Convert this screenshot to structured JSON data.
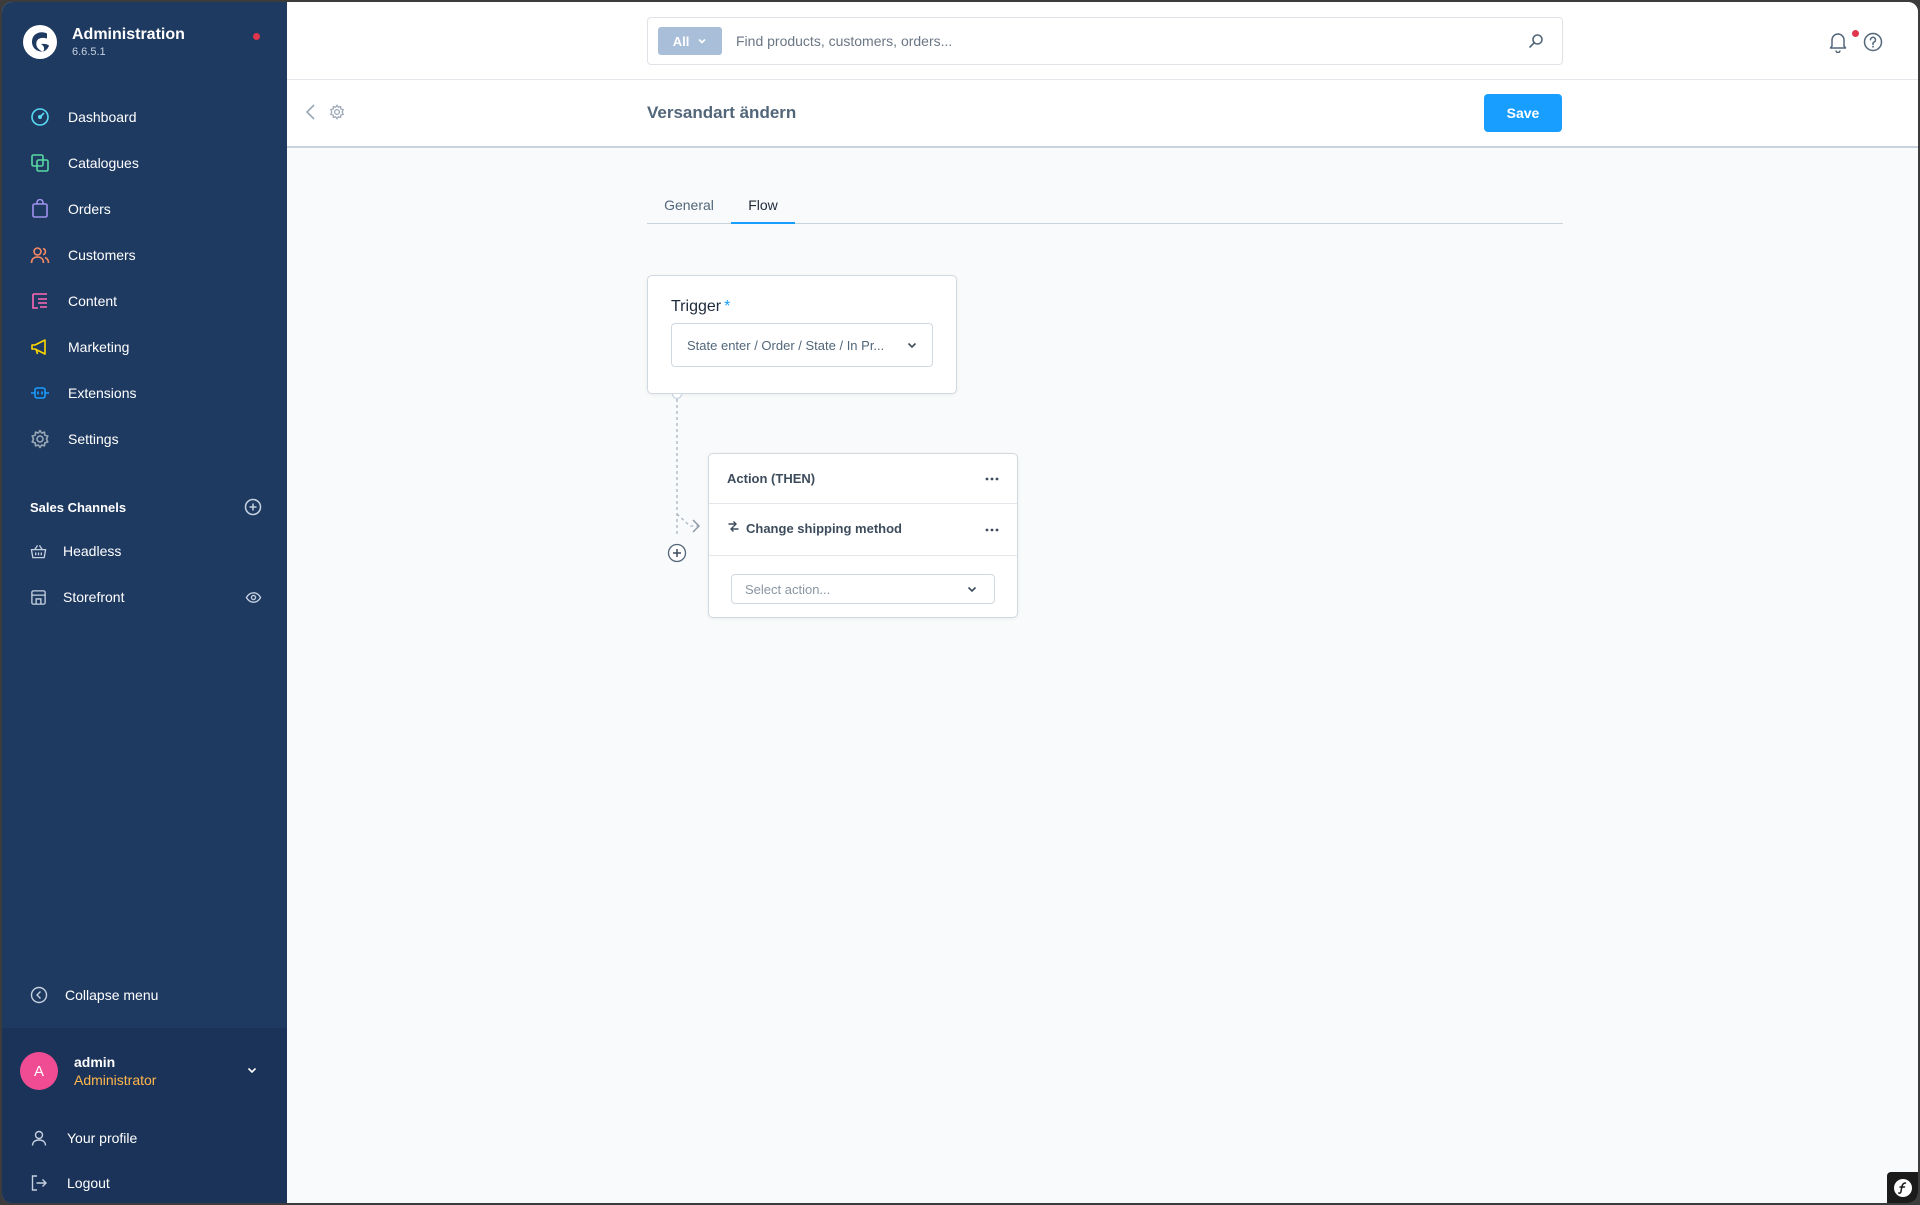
{
  "app": {
    "title": "Administration",
    "version": "6.6.5.1"
  },
  "sidebar": {
    "items": [
      {
        "label": "Dashboard",
        "icon": "dashboard-icon",
        "color": "#57d9f4"
      },
      {
        "label": "Catalogues",
        "icon": "catalogue-icon",
        "color": "#57d9a3"
      },
      {
        "label": "Orders",
        "icon": "orders-icon",
        "color": "#a092f0"
      },
      {
        "label": "Customers",
        "icon": "customers-icon",
        "color": "#f88962"
      },
      {
        "label": "Content",
        "icon": "content-icon",
        "color": "#ff68b4"
      },
      {
        "label": "Marketing",
        "icon": "marketing-icon",
        "color": "#ffd700"
      },
      {
        "label": "Extensions",
        "icon": "extensions-icon",
        "color": "#189eff"
      },
      {
        "label": "Settings",
        "icon": "settings-icon",
        "color": "#9aa8b5"
      }
    ],
    "sales_channels": {
      "title": "Sales Channels",
      "items": [
        {
          "label": "Headless",
          "icon": "basket-icon"
        },
        {
          "label": "Storefront",
          "icon": "storefront-icon"
        }
      ]
    },
    "collapse_label": "Collapse menu",
    "user": {
      "initial": "A",
      "name": "admin",
      "role": "Administrator"
    },
    "profile_label": "Your profile",
    "logout_label": "Logout"
  },
  "topbar": {
    "search_filter": "All",
    "search_placeholder": "Find products, customers, orders..."
  },
  "page": {
    "title": "Versandart ändern",
    "save_label": "Save",
    "tabs": [
      {
        "label": "General",
        "active": false
      },
      {
        "label": "Flow",
        "active": true
      }
    ]
  },
  "flow": {
    "trigger_label": "Trigger",
    "trigger_required": "*",
    "trigger_value": "State enter / Order / State / In Pr...",
    "action_title": "Action (THEN)",
    "action_item": "Change shipping method",
    "select_action_placeholder": "Select action..."
  },
  "colors": {
    "sidebar_bg": "#1f3a61",
    "accent": "#189eff",
    "role_text": "#ffb74d",
    "avatar": "#f04c94",
    "notification_dot": "#e0354a"
  }
}
